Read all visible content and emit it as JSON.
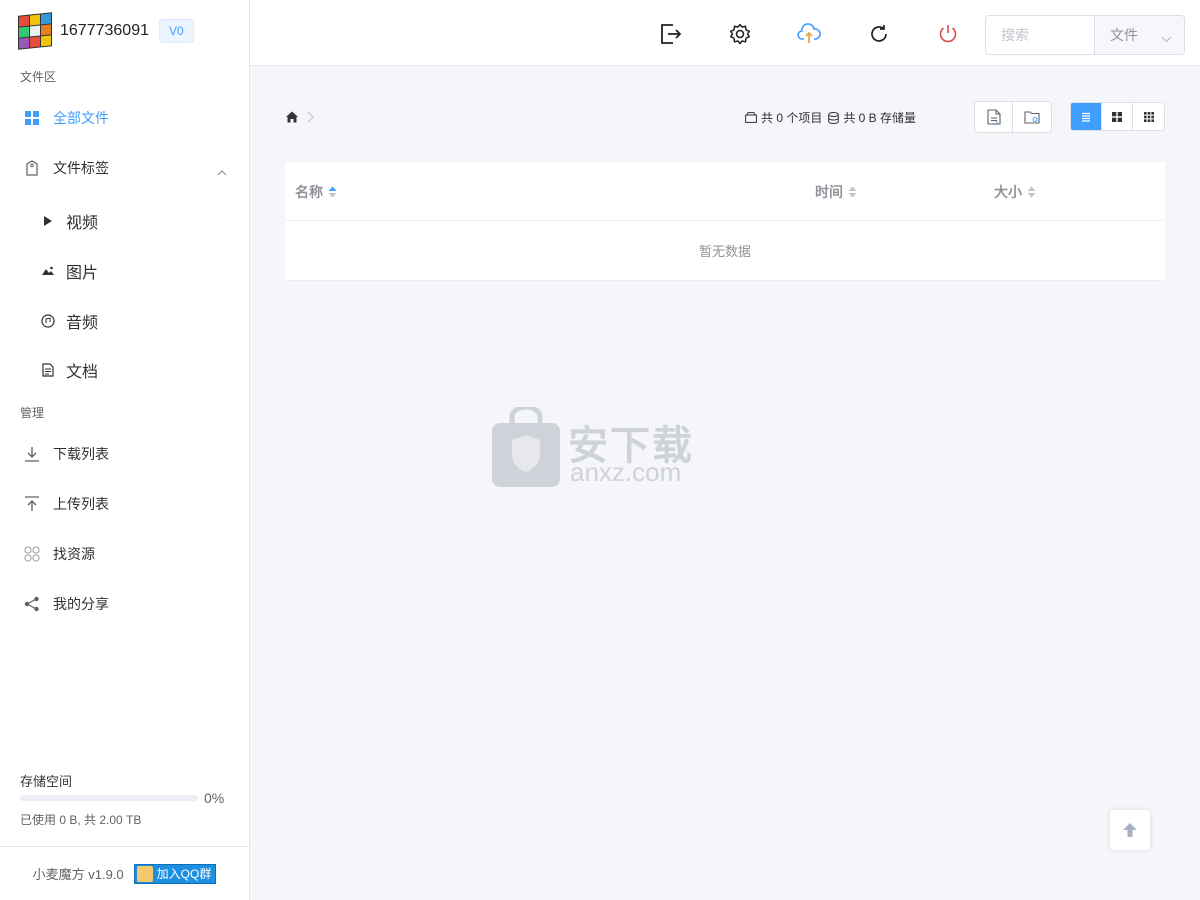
{
  "user": {
    "id": "1677736091",
    "level": "V0"
  },
  "sidebar": {
    "files_section": "文件区",
    "all_files": "全部文件",
    "tags": "文件标签",
    "tag_items": [
      "视频",
      "图片",
      "音频",
      "文档"
    ],
    "manage_section": "管理",
    "download_list": "下载列表",
    "upload_list": "上传列表",
    "find_resources": "找资源",
    "my_shares": "我的分享"
  },
  "storage": {
    "title": "存储空间",
    "percent": 0,
    "percent_label": "0%",
    "used_label": "已使用 0 B, 共 2.00 TB"
  },
  "footer": {
    "version": "小麦魔方 v1.9.0",
    "qq_button": "加入QQ群"
  },
  "header": {
    "search_placeholder": "搜索",
    "search_type": "文件",
    "icons": [
      "logout-icon",
      "settings-icon",
      "upload-cloud-icon",
      "refresh-icon",
      "power-icon"
    ]
  },
  "toolbar": {
    "item_count": "共 0 个项目",
    "storage_used": "共 0 B 存储量"
  },
  "table": {
    "columns": [
      "名称",
      "时间",
      "大小"
    ],
    "empty_text": "暂无数据"
  },
  "watermark": {
    "text": "安下载",
    "sub": "anxz.com"
  },
  "colors": {
    "accent": "#409eff",
    "power": "#e04848",
    "upload": "#409eff"
  }
}
